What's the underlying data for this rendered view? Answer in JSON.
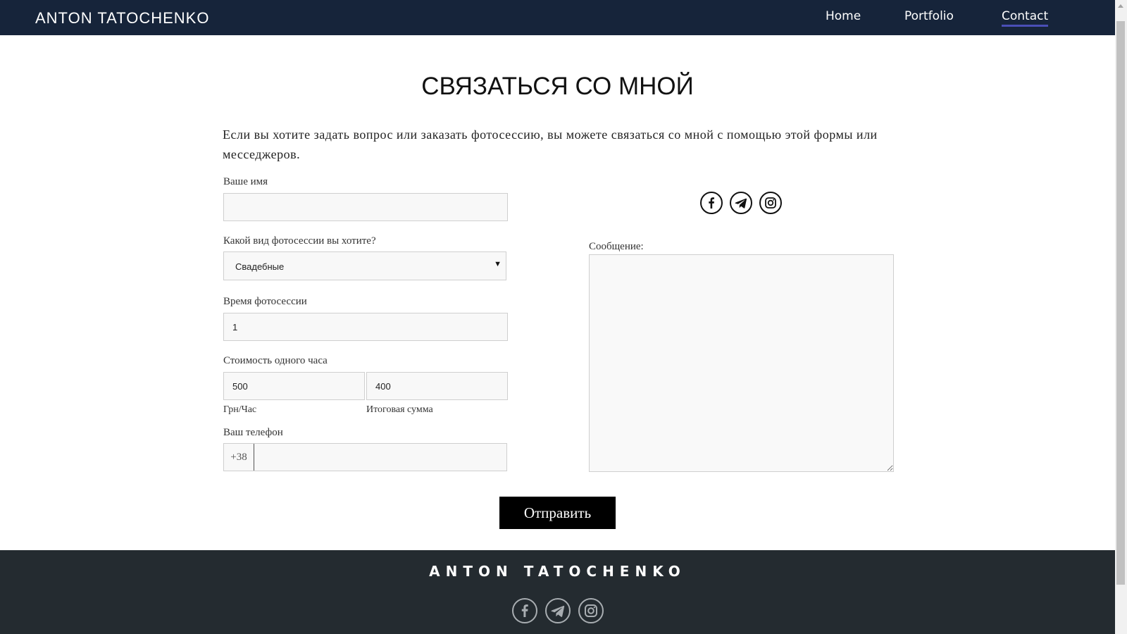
{
  "header": {
    "brand": "ANTON TATOCHENKO",
    "nav": [
      {
        "label": "Home"
      },
      {
        "label": "Portfolio"
      },
      {
        "label": "Contact",
        "active": true
      }
    ]
  },
  "main": {
    "title": "СВЯЗАТЬСЯ СО МНОЙ",
    "intro": "Если вы хотите задать вопрос или заказать фотосессию, вы можете связаться со мной с помощью этой формы или месседжеров."
  },
  "form": {
    "name_label": "Ваше имя",
    "name_value": "",
    "type_label": "Какой вид фотосессии вы хотите?",
    "type_selected": "Свадебные",
    "time_label": "Время фотосессии",
    "time_value": "1",
    "cost_label": "Стоимость одного часа",
    "rate_value": "500",
    "rate_caption": "Грн/Час",
    "total_value": "400",
    "total_caption": "Итоговая сумма",
    "phone_label": "Ваш телефон",
    "phone_prefix": "+38",
    "phone_value": "",
    "message_label": "Сообщение:",
    "message_value": "",
    "submit_label": "Отправить"
  },
  "social_icons": [
    "facebook-icon",
    "telegram-icon",
    "instagram-icon"
  ],
  "footer": {
    "brand": "ANTON TATOCHENKO"
  },
  "colors": {
    "header_bg": "#16243a",
    "nav_active_underline": "#4a4fb6",
    "footer_bg": "#242b30",
    "button_bg": "#000000"
  }
}
